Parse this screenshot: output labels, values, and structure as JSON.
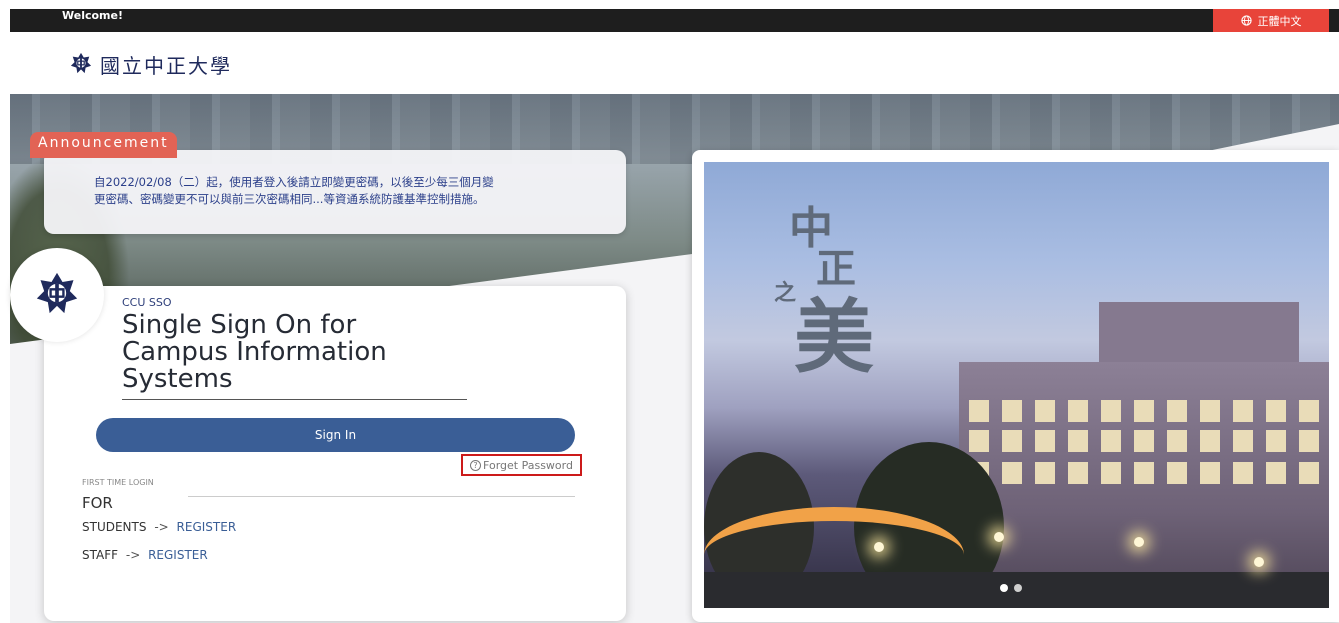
{
  "topbar": {
    "welcome": "Welcome!",
    "language_button": "正體中文",
    "language_icon": "globe-icon",
    "accent_color": "#e8443a"
  },
  "brand": {
    "logo_text": "國立中正大學",
    "logo_icon": "ccu-emblem-icon",
    "primary_color": "#3a5e96"
  },
  "announcement": {
    "label": "Announcement",
    "text_line1": "自2022/02/08（二）起，使用者登入後請立即變更密碼，以後至少每三個月變",
    "text_line2": "更密碼、密碼變更不可以與前三次密碼相同...等資通系統防護基準控制措施。",
    "label_color": "#e26355"
  },
  "login": {
    "tag": "CCU SSO",
    "title_line1": "Single Sign On for",
    "title_line2": "Campus Information",
    "title_line3": "Systems",
    "signin_label": "Sign In",
    "forget_icon": "?",
    "forget_label": "Forget Password",
    "first_time": "FIRST TIME LOGIN",
    "for_label": "FOR",
    "students_label": "STUDENTS",
    "staff_label": "STAFF",
    "arrow": "->",
    "register_label": "REGISTER"
  },
  "carousel": {
    "calligraphy_1": "中",
    "calligraphy_2": "正",
    "calligraphy_3": "之",
    "calligraphy_4": "美",
    "slide_count": 2,
    "active_slide": 1
  }
}
